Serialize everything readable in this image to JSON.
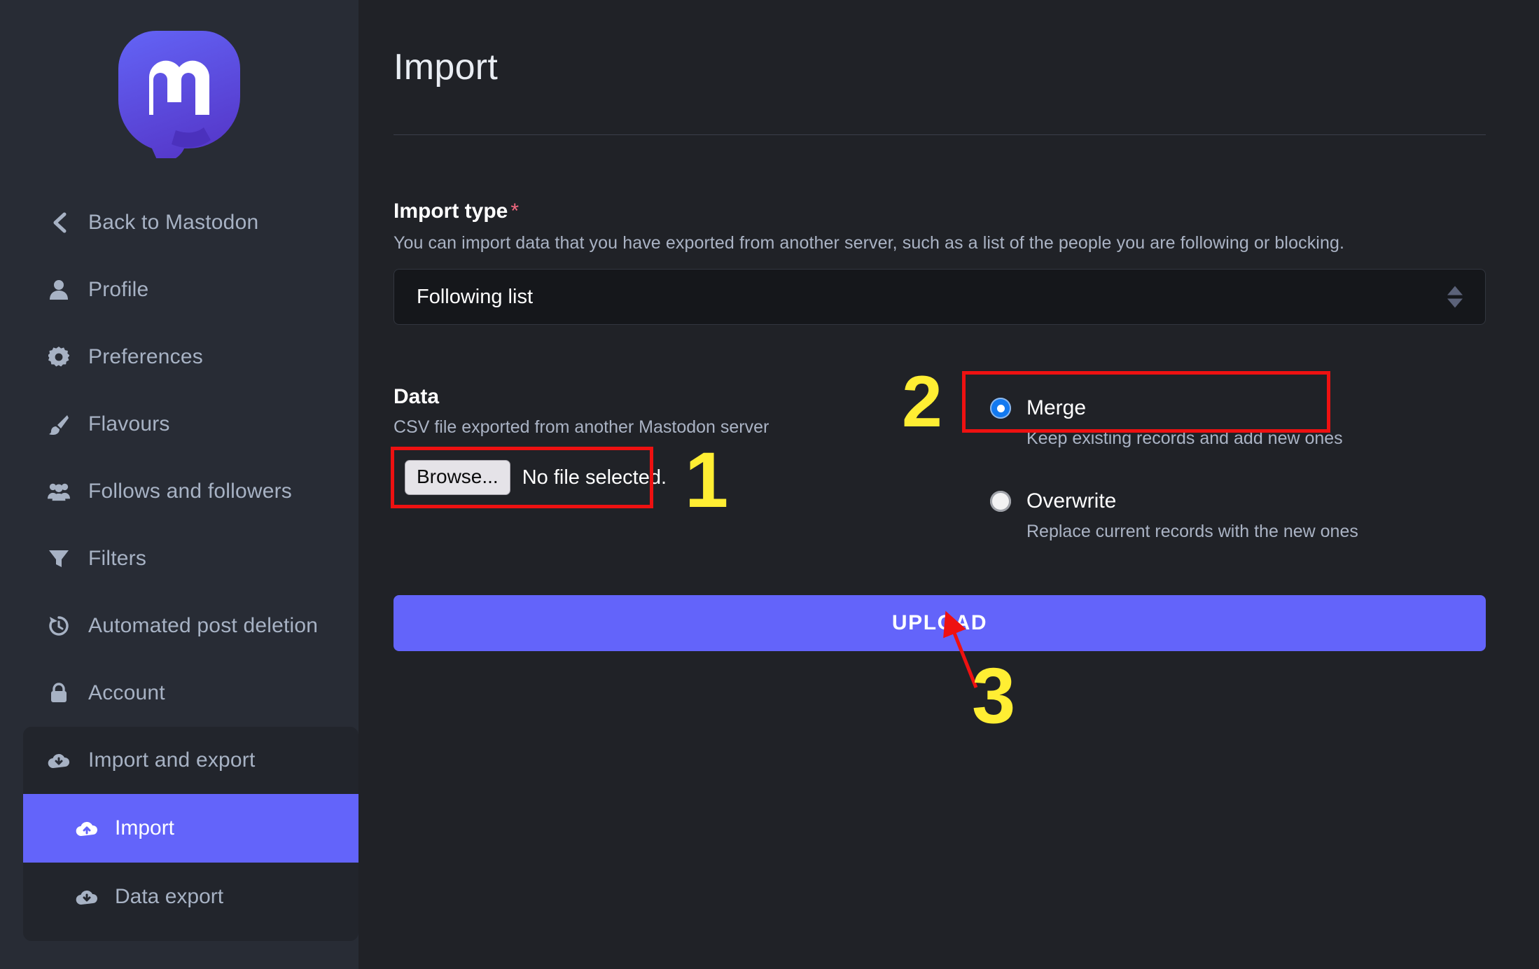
{
  "sidebar": {
    "logo_name": "mastodon-logo",
    "items": [
      {
        "label": "Back to Mastodon",
        "icon": "chevron-left-icon"
      },
      {
        "label": "Profile",
        "icon": "person-icon"
      },
      {
        "label": "Preferences",
        "icon": "gear-icon"
      },
      {
        "label": "Flavours",
        "icon": "paintbrush-icon"
      },
      {
        "label": "Follows and followers",
        "icon": "people-icon"
      },
      {
        "label": "Filters",
        "icon": "funnel-icon"
      },
      {
        "label": "Automated post deletion",
        "icon": "history-icon"
      },
      {
        "label": "Account",
        "icon": "lock-icon"
      }
    ],
    "group": {
      "label": "Import and export",
      "icon": "cloud-download-icon",
      "children": [
        {
          "label": "Import",
          "icon": "cloud-upload-icon",
          "active": true
        },
        {
          "label": "Data export",
          "icon": "cloud-download-icon",
          "active": false
        }
      ]
    }
  },
  "main": {
    "title": "Import",
    "import_type": {
      "label": "Import type",
      "required_marker": "*",
      "hint": "You can import data that you have exported from another server, such as a list of the people you are following or blocking.",
      "selected_option": "Following list"
    },
    "data": {
      "label": "Data",
      "hint": "CSV file exported from another Mastodon server",
      "browse_label": "Browse...",
      "file_status": "No file selected."
    },
    "mode": {
      "merge": {
        "title": "Merge",
        "desc": "Keep existing records and add new ones",
        "selected": true
      },
      "overwrite": {
        "title": "Overwrite",
        "desc": "Replace current records with the new ones",
        "selected": false
      }
    },
    "upload_label": "UPLOAD"
  },
  "annotations": {
    "step1": "1",
    "step2": "2",
    "step3": "3",
    "highlight_color": "#ee1111",
    "number_color": "#ffee33",
    "arrow_color": "#ee1111"
  }
}
